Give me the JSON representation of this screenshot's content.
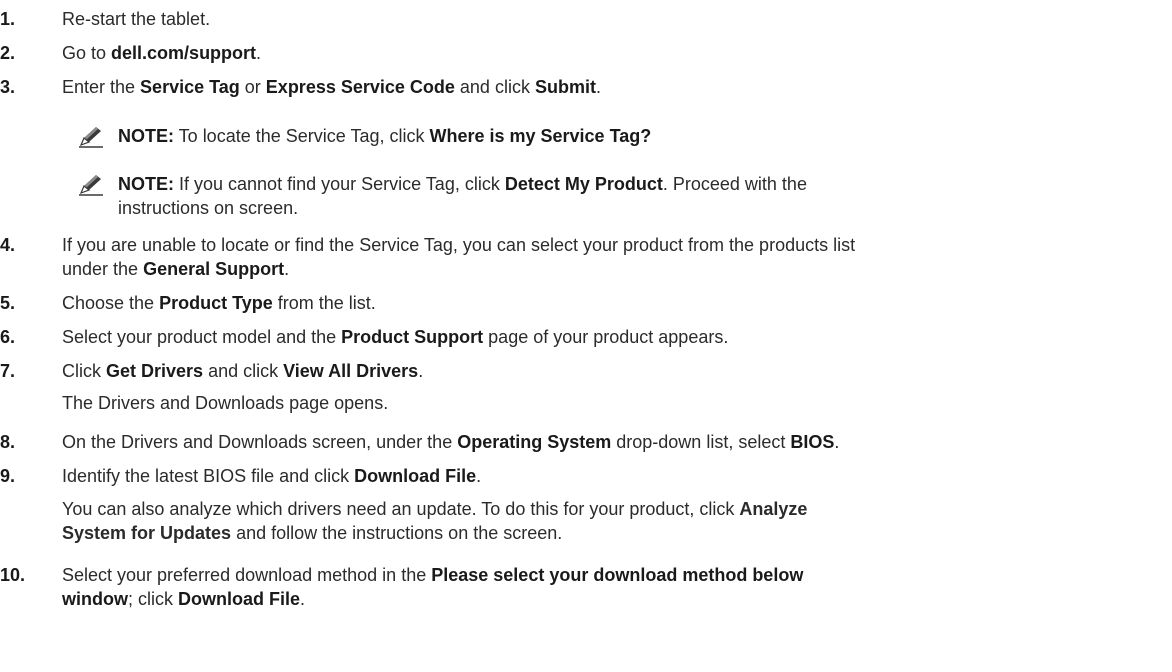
{
  "steps": [
    {
      "num": "1.",
      "parts": [
        {
          "t": "Re-start the tablet."
        }
      ]
    },
    {
      "num": "2.",
      "parts": [
        {
          "t": "Go to "
        },
        {
          "t": "dell.com/support",
          "b": true
        },
        {
          "t": "."
        }
      ]
    },
    {
      "num": "3.",
      "parts": [
        {
          "t": "Enter the "
        },
        {
          "t": "Service Tag",
          "b": true
        },
        {
          "t": " or "
        },
        {
          "t": "Express Service Code",
          "b": true
        },
        {
          "t": " and click "
        },
        {
          "t": "Submit",
          "b": true
        },
        {
          "t": "."
        }
      ]
    },
    {
      "num": "4.",
      "parts": [
        {
          "t": "If you are unable to locate or find the Service Tag, you can select your product from the products list"
        }
      ],
      "line2": [
        {
          "t": "under the "
        },
        {
          "t": "General Support",
          "b": true
        },
        {
          "t": "."
        }
      ]
    },
    {
      "num": "5.",
      "parts": [
        {
          "t": "Choose the "
        },
        {
          "t": "Product Type",
          "b": true
        },
        {
          "t": " from the list."
        }
      ]
    },
    {
      "num": "6.",
      "parts": [
        {
          "t": "Select your product model and the "
        },
        {
          "t": "Product Support",
          "b": true
        },
        {
          "t": " page of your product appears."
        }
      ]
    },
    {
      "num": "7.",
      "parts": [
        {
          "t": "Click "
        },
        {
          "t": "Get Drivers",
          "b": true
        },
        {
          "t": " and click "
        },
        {
          "t": "View All Drivers",
          "b": true
        },
        {
          "t": "."
        }
      ],
      "extra": "The Drivers and Downloads page opens."
    },
    {
      "num": "8.",
      "parts": [
        {
          "t": "On the Drivers and Downloads screen, under the "
        },
        {
          "t": "Operating System",
          "b": true
        },
        {
          "t": " drop-down list, select "
        },
        {
          "t": "BIOS",
          "b": true
        },
        {
          "t": "."
        }
      ]
    },
    {
      "num": "9.",
      "parts": [
        {
          "t": "Identify the latest BIOS file and click "
        },
        {
          "t": "Download File",
          "b": true
        },
        {
          "t": "."
        }
      ],
      "extra_parts": [
        {
          "t": "You can also analyze which drivers need an update. To do this for your product, click "
        },
        {
          "t": "Analyze",
          "b": true
        }
      ],
      "extra_parts2": [
        {
          "t": "System for Updates",
          "b": true
        },
        {
          "t": " and follow the instructions on the screen."
        }
      ]
    },
    {
      "num": "10.",
      "parts": [
        {
          "t": "Select your preferred download method in the "
        },
        {
          "t": "Please select your download method below",
          "b": true
        }
      ],
      "line2": [
        {
          "t": "window",
          "b": true
        },
        {
          "t": "; click "
        },
        {
          "t": "Download File",
          "b": true
        },
        {
          "t": "."
        }
      ]
    }
  ],
  "notes": [
    {
      "label": "NOTE:",
      "parts": [
        {
          "t": " To locate the Service Tag, click "
        },
        {
          "t": "Where is my Service Tag?",
          "b": true
        }
      ]
    },
    {
      "label": "NOTE:",
      "parts": [
        {
          "t": " If you cannot find your Service Tag, click "
        },
        {
          "t": "Detect My Product",
          "b": true
        },
        {
          "t": ". Proceed with the"
        }
      ],
      "line2": [
        {
          "t": "instructions on screen."
        }
      ]
    }
  ],
  "note_icon": "pencil-note-icon"
}
